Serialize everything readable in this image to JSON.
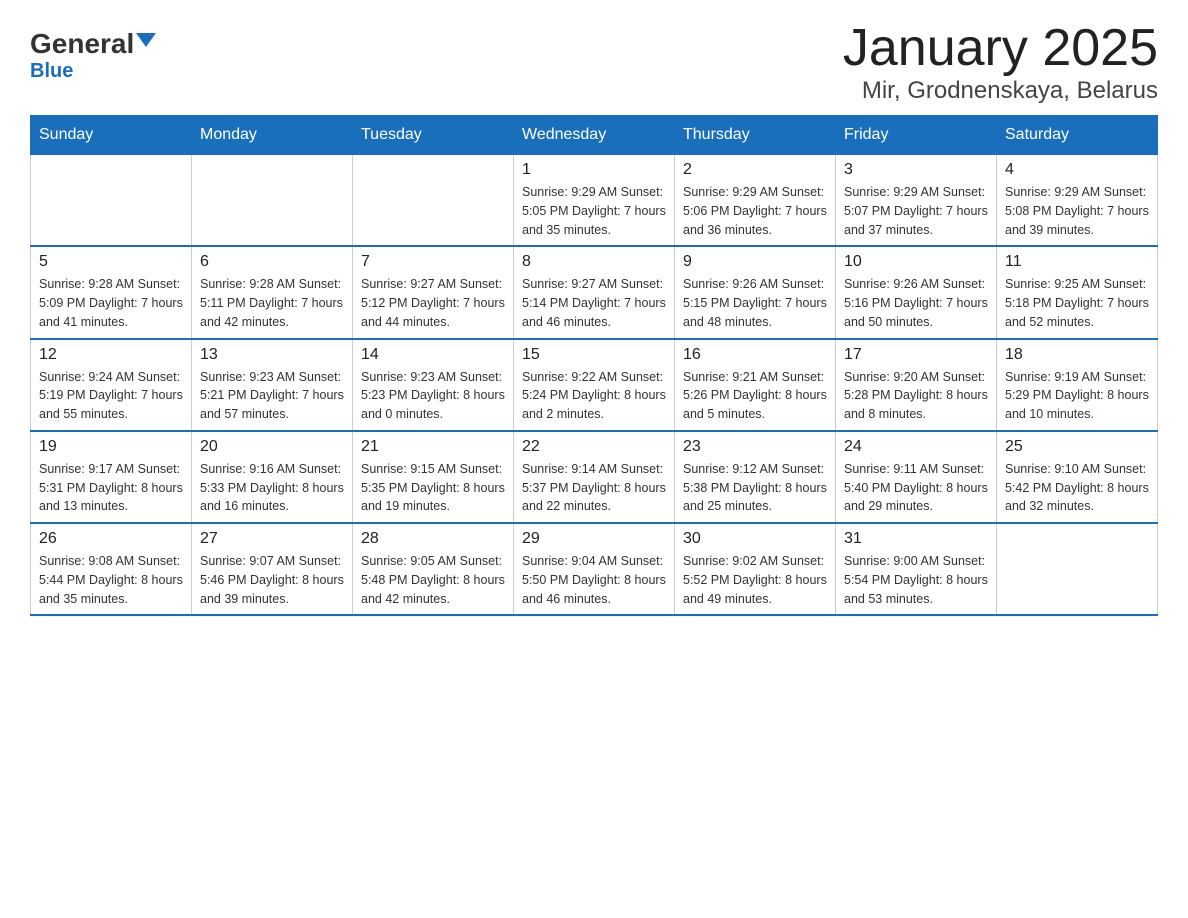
{
  "logo": {
    "general": "General",
    "blue": "Blue"
  },
  "title": "January 2025",
  "subtitle": "Mir, Grodnenskaya, Belarus",
  "days": [
    "Sunday",
    "Monday",
    "Tuesday",
    "Wednesday",
    "Thursday",
    "Friday",
    "Saturday"
  ],
  "weeks": [
    [
      {
        "day": "",
        "info": ""
      },
      {
        "day": "",
        "info": ""
      },
      {
        "day": "",
        "info": ""
      },
      {
        "day": "1",
        "info": "Sunrise: 9:29 AM\nSunset: 5:05 PM\nDaylight: 7 hours\nand 35 minutes."
      },
      {
        "day": "2",
        "info": "Sunrise: 9:29 AM\nSunset: 5:06 PM\nDaylight: 7 hours\nand 36 minutes."
      },
      {
        "day": "3",
        "info": "Sunrise: 9:29 AM\nSunset: 5:07 PM\nDaylight: 7 hours\nand 37 minutes."
      },
      {
        "day": "4",
        "info": "Sunrise: 9:29 AM\nSunset: 5:08 PM\nDaylight: 7 hours\nand 39 minutes."
      }
    ],
    [
      {
        "day": "5",
        "info": "Sunrise: 9:28 AM\nSunset: 5:09 PM\nDaylight: 7 hours\nand 41 minutes."
      },
      {
        "day": "6",
        "info": "Sunrise: 9:28 AM\nSunset: 5:11 PM\nDaylight: 7 hours\nand 42 minutes."
      },
      {
        "day": "7",
        "info": "Sunrise: 9:27 AM\nSunset: 5:12 PM\nDaylight: 7 hours\nand 44 minutes."
      },
      {
        "day": "8",
        "info": "Sunrise: 9:27 AM\nSunset: 5:14 PM\nDaylight: 7 hours\nand 46 minutes."
      },
      {
        "day": "9",
        "info": "Sunrise: 9:26 AM\nSunset: 5:15 PM\nDaylight: 7 hours\nand 48 minutes."
      },
      {
        "day": "10",
        "info": "Sunrise: 9:26 AM\nSunset: 5:16 PM\nDaylight: 7 hours\nand 50 minutes."
      },
      {
        "day": "11",
        "info": "Sunrise: 9:25 AM\nSunset: 5:18 PM\nDaylight: 7 hours\nand 52 minutes."
      }
    ],
    [
      {
        "day": "12",
        "info": "Sunrise: 9:24 AM\nSunset: 5:19 PM\nDaylight: 7 hours\nand 55 minutes."
      },
      {
        "day": "13",
        "info": "Sunrise: 9:23 AM\nSunset: 5:21 PM\nDaylight: 7 hours\nand 57 minutes."
      },
      {
        "day": "14",
        "info": "Sunrise: 9:23 AM\nSunset: 5:23 PM\nDaylight: 8 hours\nand 0 minutes."
      },
      {
        "day": "15",
        "info": "Sunrise: 9:22 AM\nSunset: 5:24 PM\nDaylight: 8 hours\nand 2 minutes."
      },
      {
        "day": "16",
        "info": "Sunrise: 9:21 AM\nSunset: 5:26 PM\nDaylight: 8 hours\nand 5 minutes."
      },
      {
        "day": "17",
        "info": "Sunrise: 9:20 AM\nSunset: 5:28 PM\nDaylight: 8 hours\nand 8 minutes."
      },
      {
        "day": "18",
        "info": "Sunrise: 9:19 AM\nSunset: 5:29 PM\nDaylight: 8 hours\nand 10 minutes."
      }
    ],
    [
      {
        "day": "19",
        "info": "Sunrise: 9:17 AM\nSunset: 5:31 PM\nDaylight: 8 hours\nand 13 minutes."
      },
      {
        "day": "20",
        "info": "Sunrise: 9:16 AM\nSunset: 5:33 PM\nDaylight: 8 hours\nand 16 minutes."
      },
      {
        "day": "21",
        "info": "Sunrise: 9:15 AM\nSunset: 5:35 PM\nDaylight: 8 hours\nand 19 minutes."
      },
      {
        "day": "22",
        "info": "Sunrise: 9:14 AM\nSunset: 5:37 PM\nDaylight: 8 hours\nand 22 minutes."
      },
      {
        "day": "23",
        "info": "Sunrise: 9:12 AM\nSunset: 5:38 PM\nDaylight: 8 hours\nand 25 minutes."
      },
      {
        "day": "24",
        "info": "Sunrise: 9:11 AM\nSunset: 5:40 PM\nDaylight: 8 hours\nand 29 minutes."
      },
      {
        "day": "25",
        "info": "Sunrise: 9:10 AM\nSunset: 5:42 PM\nDaylight: 8 hours\nand 32 minutes."
      }
    ],
    [
      {
        "day": "26",
        "info": "Sunrise: 9:08 AM\nSunset: 5:44 PM\nDaylight: 8 hours\nand 35 minutes."
      },
      {
        "day": "27",
        "info": "Sunrise: 9:07 AM\nSunset: 5:46 PM\nDaylight: 8 hours\nand 39 minutes."
      },
      {
        "day": "28",
        "info": "Sunrise: 9:05 AM\nSunset: 5:48 PM\nDaylight: 8 hours\nand 42 minutes."
      },
      {
        "day": "29",
        "info": "Sunrise: 9:04 AM\nSunset: 5:50 PM\nDaylight: 8 hours\nand 46 minutes."
      },
      {
        "day": "30",
        "info": "Sunrise: 9:02 AM\nSunset: 5:52 PM\nDaylight: 8 hours\nand 49 minutes."
      },
      {
        "day": "31",
        "info": "Sunrise: 9:00 AM\nSunset: 5:54 PM\nDaylight: 8 hours\nand 53 minutes."
      },
      {
        "day": "",
        "info": ""
      }
    ]
  ]
}
